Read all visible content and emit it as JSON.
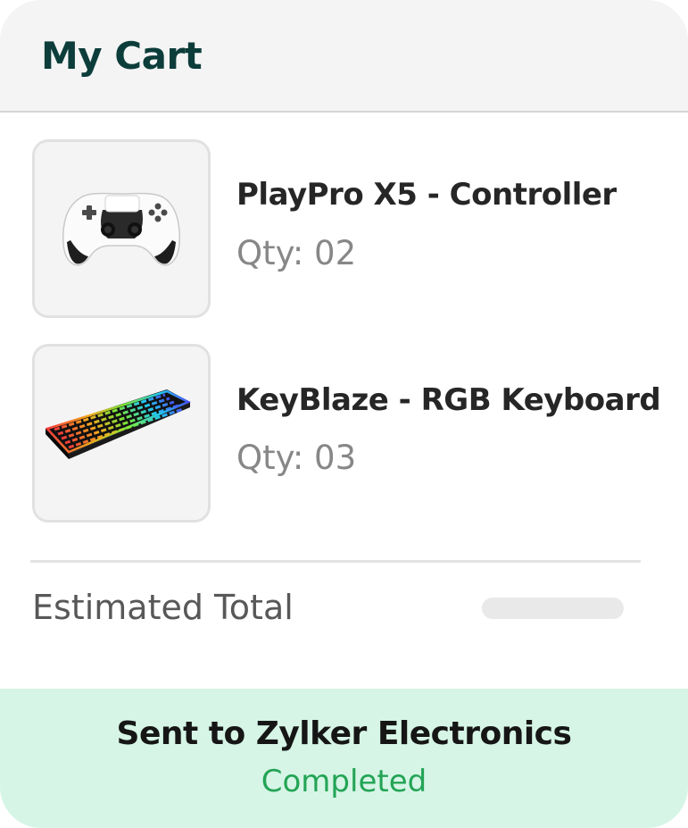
{
  "header": {
    "title": "My Cart"
  },
  "cart": {
    "items": [
      {
        "name": "PlayPro X5 - Controller",
        "qty": "Qty: 02",
        "image_icon": "game-controller-icon"
      },
      {
        "name": "KeyBlaze - RGB Keyboard",
        "qty": "Qty: 03",
        "image_icon": "rgb-keyboard-icon"
      }
    ]
  },
  "summary": {
    "total_label": "Estimated Total"
  },
  "status": {
    "title": "Sent to Zylker Electronics",
    "value": "Completed",
    "color": "#23a455",
    "background": "#d6f5e6"
  }
}
